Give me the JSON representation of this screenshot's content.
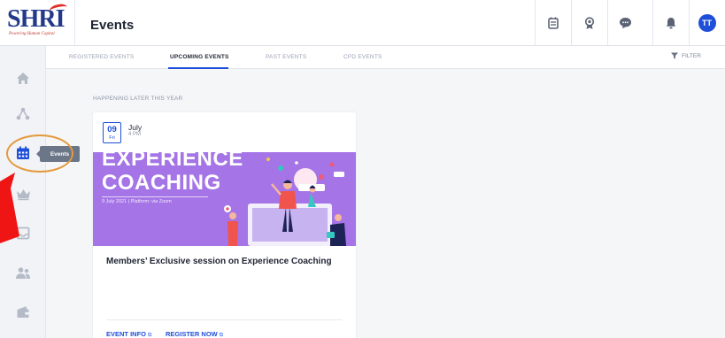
{
  "header": {
    "logo_text": "SHRI",
    "logo_tagline": "Powering Human Capital",
    "title": "Events",
    "icons": [
      "calendar-badge-icon",
      "award-icon",
      "chat-icon",
      "bell-icon"
    ],
    "avatar_initials": "TT"
  },
  "tabs": [
    {
      "label": "REGISTERED EVENTS",
      "active": false
    },
    {
      "label": "UPCOMING EVENTS",
      "active": true
    },
    {
      "label": "PAST EVENTS",
      "active": false
    },
    {
      "label": "CPD EVENTS",
      "active": false
    }
  ],
  "filter_label": "FILTER",
  "sidebar": {
    "items": [
      "home-icon",
      "network-icon",
      "events-icon",
      "crown-icon",
      "inbox-icon",
      "members-icon",
      "wallet-icon"
    ],
    "active": "events-icon",
    "tooltip": "Events"
  },
  "section_label": "HAPPENING LATER THIS YEAR",
  "event": {
    "day": "09",
    "weekday": "Fri",
    "month": "July",
    "time": "4 PM",
    "banner_line1": "EXPERIENCE",
    "banner_line2": "COACHING",
    "banner_sub": "9 July 2021  |  Platform: via Zoom",
    "title": "Members’ Exclusive session on Experience Coaching",
    "link_info": "EVENT INFO",
    "link_register": "REGISTER NOW"
  },
  "colors": {
    "accent": "#1f4fd8",
    "banner": "#a574e6",
    "background": "#98a6c4",
    "highlight": "#e49a3c",
    "annotation_arrow": "#f01515"
  }
}
